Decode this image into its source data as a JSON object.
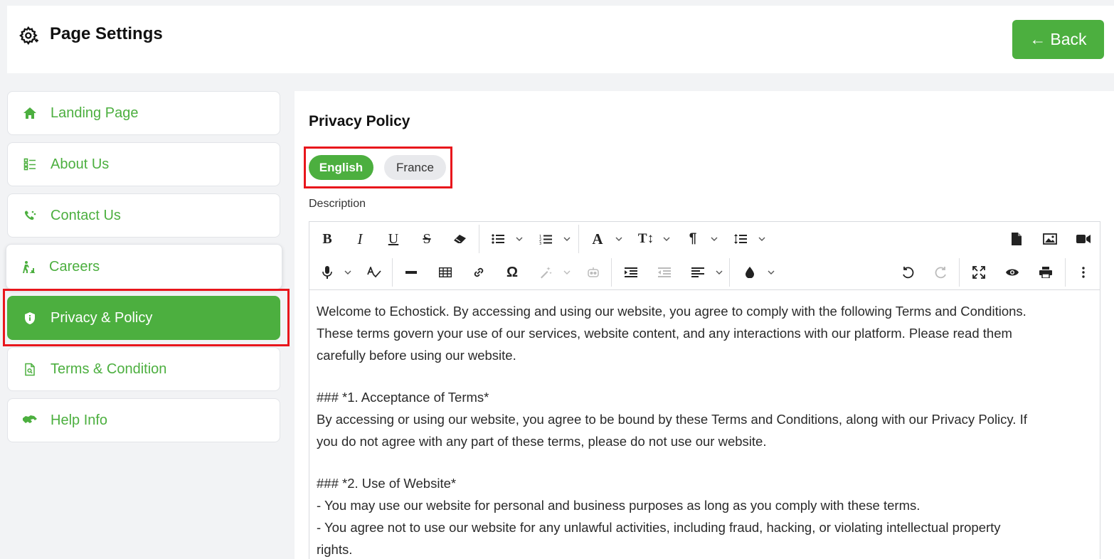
{
  "header": {
    "title": "Page Settings",
    "back_label": "Back"
  },
  "sidebar": {
    "items": [
      {
        "label": "Landing Page",
        "icon": "home-icon"
      },
      {
        "label": "About Us",
        "icon": "list-icon"
      },
      {
        "label": "Contact Us",
        "icon": "contact-icon"
      },
      {
        "label": "Careers",
        "icon": "careers-icon"
      },
      {
        "label": "Privacy & Policy",
        "icon": "shield-icon",
        "active": true
      },
      {
        "label": "Terms & Condition",
        "icon": "document-icon"
      },
      {
        "label": "Help Info",
        "icon": "handshake-icon"
      }
    ]
  },
  "main": {
    "title": "Privacy Policy",
    "languages": [
      {
        "label": "English",
        "selected": true
      },
      {
        "label": "France",
        "selected": false
      }
    ],
    "description_label": "Description",
    "content": {
      "p1": "Welcome to Echostick. By accessing and using our website, you agree to comply with the following Terms and Conditions.",
      "p2": "These terms govern your use of our services, website content, and any interactions with our platform. Please read them",
      "p3": "carefully before using our website.",
      "h1": "### *1. Acceptance of Terms*",
      "p4": "By accessing or using our website, you agree to be bound by these Terms and Conditions, along with our Privacy Policy. If",
      "p5": "you do not agree with any part of these terms, please do not use our website.",
      "h2": "### *2. Use of Website*",
      "p6": "- You may use our website for personal and business purposes as long as you comply with these terms.",
      "p7": "- You agree not to use our website for any unlawful activities, including fraud, hacking, or violating intellectual property",
      "p8": "rights."
    }
  },
  "colors": {
    "accent": "#4caf3f",
    "highlight": "#e8161c"
  }
}
